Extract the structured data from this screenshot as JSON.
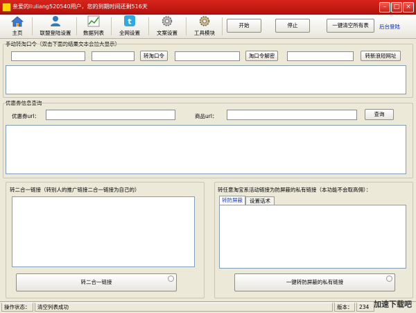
{
  "window": {
    "title": "亲爱的liuliang520540用户，您的到期时间还剩516天",
    "min": "–",
    "max": "□",
    "close": "×"
  },
  "toolbar": {
    "items": [
      {
        "label": "主页",
        "icon": "home-icon"
      },
      {
        "label": "联盟登陆设置",
        "icon": "user-icon"
      },
      {
        "label": "数据列表",
        "icon": "chart-icon"
      },
      {
        "label": "全网设置",
        "icon": "twitter-bird-icon"
      },
      {
        "label": "文案设置",
        "icon": "gear-icon"
      },
      {
        "label": "工具模块",
        "icon": "gear-icon"
      }
    ],
    "start": "开始",
    "stop": "停止",
    "clear_all": "一键清空所有表",
    "admin_login": "后台登陆"
  },
  "manual": {
    "title": "手动转淘口令（双击下面的结果文本会拉大显示）",
    "convert_tkl": "转淘口令",
    "decode_tkl": "淘口令解密",
    "convert_short": "转新浪短网址"
  },
  "coupon": {
    "title": "优惠券信息查询",
    "coupon_url_label": "优惠券url：",
    "product_url_label": "商品url：",
    "query": "查询"
  },
  "merge": {
    "title": "转二合一链接（转别人的推广链接二合一链接为自己的）",
    "button": "转二合一链接"
  },
  "anti": {
    "title": "转任意淘宝系活动链接为防屏蔽的私有链接（本功能不会取高佣）：",
    "tabs": [
      "转防屏蔽",
      "设置话术"
    ],
    "button": "一键转防屏蔽的私有链接"
  },
  "status": {
    "label": "操作状态：",
    "message": "清空列表成功",
    "version_label": "版本：",
    "version": "234"
  },
  "watermark": "加速下载吧",
  "colors": {
    "titlebar": "#c41b13",
    "link": "#0b2ac2",
    "window_bg": "#ece9d8"
  }
}
